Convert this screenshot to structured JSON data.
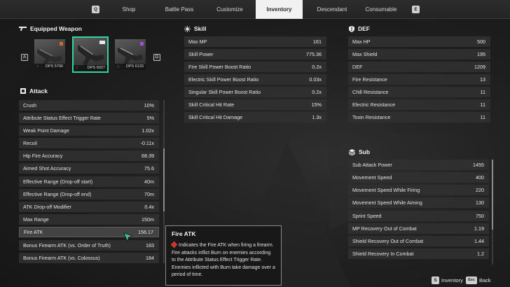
{
  "nav": {
    "left_key": "Q",
    "right_key": "E",
    "tabs": [
      {
        "label": "Shop"
      },
      {
        "label": "Battle Pass"
      },
      {
        "label": "Customize"
      },
      {
        "label": "Inventory"
      },
      {
        "label": "Descendant"
      },
      {
        "label": "Consumable"
      }
    ],
    "active_tab": "Inventory"
  },
  "equipped": {
    "title": "Equipped Weapon",
    "prev_key": "A",
    "next_key": "D",
    "slots": [
      {
        "level": "7",
        "dps": "DPS 5790"
      },
      {
        "level": "7",
        "dps": "DPS 6027"
      },
      {
        "level": "3",
        "dps": "DPS 6133"
      }
    ]
  },
  "attack": {
    "title": "Attack",
    "rows": [
      {
        "label": "Crush",
        "value": "10%"
      },
      {
        "label": "Attribute Status Effect Trigger Rate",
        "value": "5%"
      },
      {
        "label": "Weak Point Damage",
        "value": "1.02x"
      },
      {
        "label": "Recoil",
        "value": "-0.11x"
      },
      {
        "label": "Hip Fire Accuracy",
        "value": "68.39"
      },
      {
        "label": "Aimed Shot Accuracy",
        "value": "75.6"
      },
      {
        "label": "Effective Range (Drop-off start)",
        "value": "40m"
      },
      {
        "label": "Effective Range (Drop-off end)",
        "value": "70m"
      },
      {
        "label": "ATK Drop-off Modifier",
        "value": "0.4x"
      },
      {
        "label": "Max Range",
        "value": "150m"
      },
      {
        "label": "Fire ATK",
        "value": "156.17"
      },
      {
        "label": "Bonus Firearm ATK (vs. Order of Truth)",
        "value": "183"
      },
      {
        "label": "Bonus Firearm ATK (vs. Colossus)",
        "value": "184"
      }
    ]
  },
  "skill": {
    "title": "Skill",
    "rows": [
      {
        "label": "Max MP",
        "value": "161"
      },
      {
        "label": "Skill Power",
        "value": "775.36"
      },
      {
        "label": "Fire Skill Power Boost Ratio",
        "value": "0.2x"
      },
      {
        "label": "Electric Skill Power Boost Ratio",
        "value": "0.03x"
      },
      {
        "label": "Singular Skill Power Boost Ratio",
        "value": "0.2x"
      },
      {
        "label": "Skill Critical Hit Rate",
        "value": "15%"
      },
      {
        "label": "Skill Critical Hit Damage",
        "value": "1.3x"
      }
    ]
  },
  "def": {
    "title": "DEF",
    "rows": [
      {
        "label": "Max HP",
        "value": "500"
      },
      {
        "label": "Max Shield",
        "value": "195"
      },
      {
        "label": "DEF",
        "value": "1209"
      },
      {
        "label": "Fire Resistance",
        "value": "13"
      },
      {
        "label": "Chill Resistance",
        "value": "11"
      },
      {
        "label": "Electric Resistance",
        "value": "11"
      },
      {
        "label": "Toxin Resistance",
        "value": "11"
      }
    ]
  },
  "sub": {
    "title": "Sub",
    "rows": [
      {
        "label": "Sub Attack Power",
        "value": "1455"
      },
      {
        "label": "Movement Speed",
        "value": "400"
      },
      {
        "label": "Movement Speed While Firing",
        "value": "220"
      },
      {
        "label": "Movement Speed While Aiming",
        "value": "130"
      },
      {
        "label": "Sprint Speed",
        "value": "750"
      },
      {
        "label": "MP Recovery Out of Combat",
        "value": "1.19"
      },
      {
        "label": "Shield Recovery Out of Combat",
        "value": "1.44"
      },
      {
        "label": "Shield Recovery In Combat",
        "value": "1.2"
      }
    ]
  },
  "tooltip": {
    "title": "Fire ATK",
    "body": "Indicates the Fire ATK when firing a firearm. Fire attacks inflict Burn on enemies according to the Attribute Status Effect Trigger Rate. Enemies inflicted with Burn take damage over a period of time."
  },
  "footer": {
    "inventory_key": "S",
    "inventory_label": "Inventory",
    "back_key": "Esc",
    "back_label": "Back"
  },
  "colors": {
    "accent_selected": "#2fd4a2",
    "fire_icon": "#c33a2e",
    "active_tab_bg": "#f1f1f1"
  }
}
